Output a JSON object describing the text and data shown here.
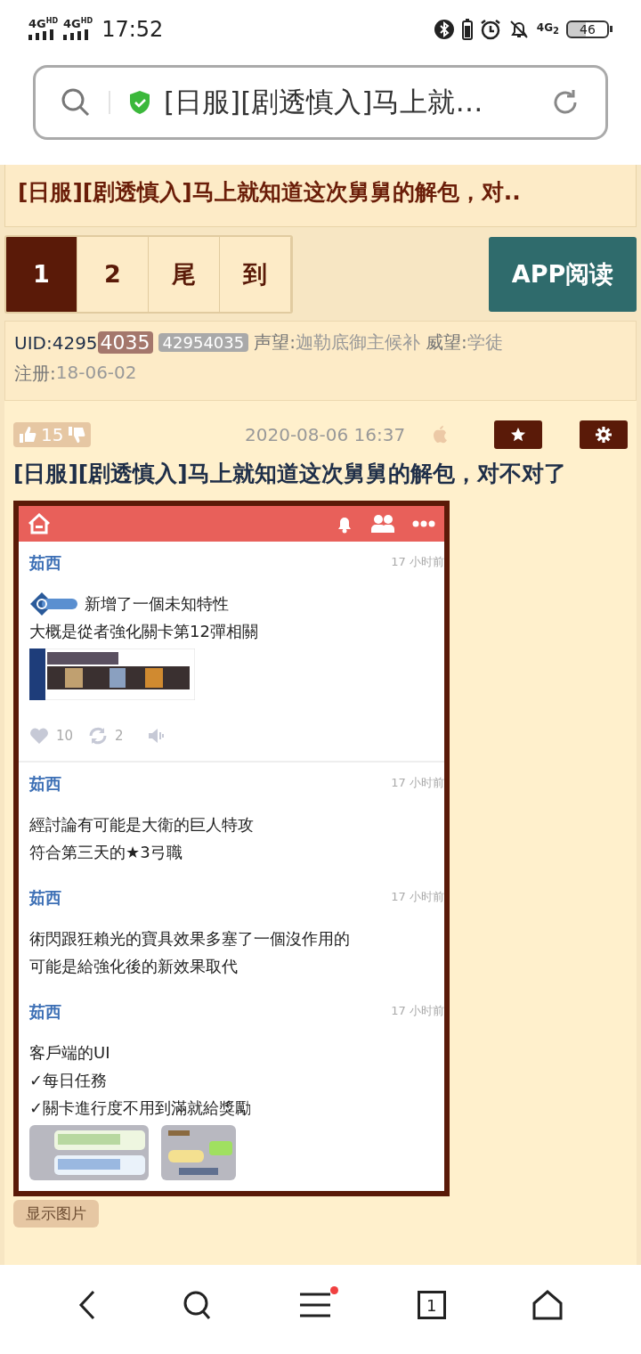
{
  "status_bar": {
    "networks": [
      "4G$^{HD}$",
      "4G$^{HD}$"
    ],
    "time": "17:52",
    "data_network": "4G$_{2}$",
    "battery": "46"
  },
  "url_bar": {
    "title": "[日服][剧透慎入]马上就…",
    "secure": true
  },
  "thread_title": "[日服][剧透慎入]马上就知道这次舅舅的解包，对..",
  "pagination": {
    "pages": [
      {
        "label": "1",
        "selected": true
      },
      {
        "label": "2",
        "selected": false
      },
      {
        "label": "尾",
        "selected": false
      },
      {
        "label": "到",
        "selected": false
      }
    ],
    "app_button": "APP阅读"
  },
  "user": {
    "uid_label": "UID:4295",
    "uid_highlight": "4035",
    "uid_badge": "42954035",
    "fame_label": "声望:",
    "fame": "迦勒底御主候补",
    "prestige_label": "威望:",
    "prestige": "学徒",
    "registered_label": "注册:",
    "registered": "18-06-02"
  },
  "post": {
    "votes": "15",
    "title": "[日服][剧透慎入]马上就知道这次舅舅的解包，对不对了",
    "date": "2020-08-06 16:37",
    "embedded": {
      "entries": [
        {
          "author": "茹西",
          "time": "17 小时前",
          "badge": true,
          "lines": [
            "新增了一個未知特性",
            "大概是從者強化關卡第12彈相關"
          ],
          "images": [
            {
              "kind": "strip"
            }
          ],
          "likes": "10",
          "reposts": "2"
        },
        {
          "author": "茹西",
          "time": "17 小时前",
          "badge": false,
          "lines": [
            "經討論有可能是大衛的巨人特攻",
            "符合第三天的★3弓職"
          ]
        },
        {
          "author": "茹西",
          "time": "17 小时前",
          "badge": false,
          "lines": [
            "術閃跟狂賴光的寶具效果多塞了一個沒作用的",
            "可能是給強化後的新效果取代"
          ]
        },
        {
          "author": "茹西",
          "time": "17 小时前",
          "badge": false,
          "lines": [
            "客戶端的UI",
            "✓每日任務",
            "✓關卡進行度不用到滿就給獎勵"
          ],
          "images": [
            {
              "kind": "bars"
            },
            {
              "kind": "panel"
            }
          ]
        }
      ]
    },
    "show_images_button": "显示图片"
  },
  "bottom_nav": {
    "menu_notification": true,
    "tab_count": "1"
  }
}
